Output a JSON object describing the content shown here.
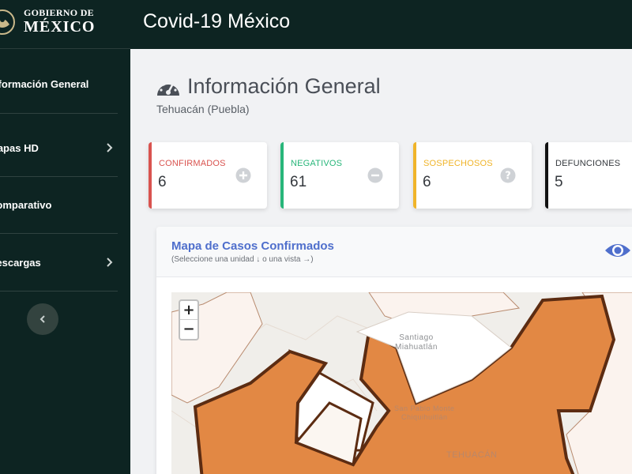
{
  "brand": {
    "top": "GOBIERNO DE",
    "bottom": "MÉXICO"
  },
  "app_title": "Covid-19 México",
  "sidebar": {
    "items": [
      {
        "label": "Información General",
        "has_chevron": false
      },
      {
        "label": "Mapas HD",
        "has_chevron": true
      },
      {
        "label": "Comparativo",
        "has_chevron": false
      },
      {
        "label": "Descargas",
        "has_chevron": true
      }
    ],
    "collapse_icon": "chevron-left-icon"
  },
  "page": {
    "icon": "dashboard-gauge-icon",
    "title": "Información General",
    "subtitle": "Tehuacán (Puebla)"
  },
  "cards": [
    {
      "label": "CONFIRMADOS",
      "value": "6",
      "color": "#d9534f",
      "icon": "plus-circle-icon"
    },
    {
      "label": "NEGATIVOS",
      "value": "61",
      "color": "#28b67a",
      "icon": "minus-circle-icon"
    },
    {
      "label": "SOSPECHOSOS",
      "value": "6",
      "color": "#f0b429",
      "icon": "question-circle-icon"
    },
    {
      "label": "DEFUNCIONES",
      "value": "5",
      "color": "#111111",
      "icon": ""
    }
  ],
  "map": {
    "title": "Mapa de Casos Confirmados",
    "subtitle": "(Seleccione una unidad ↓ o una vista →)",
    "toggle_icon": "eye-icon",
    "zoom_in": "+",
    "zoom_out": "−",
    "labels": {
      "santiago": "Santiago\nMiahuatlán",
      "chilac": "San Pablo Monte\nChiquihuitlán",
      "tehuacan": "TEHUACÁN"
    },
    "colors": {
      "high": "#e28844",
      "low": "#fbf3ee",
      "border": "#5c2c12"
    }
  }
}
